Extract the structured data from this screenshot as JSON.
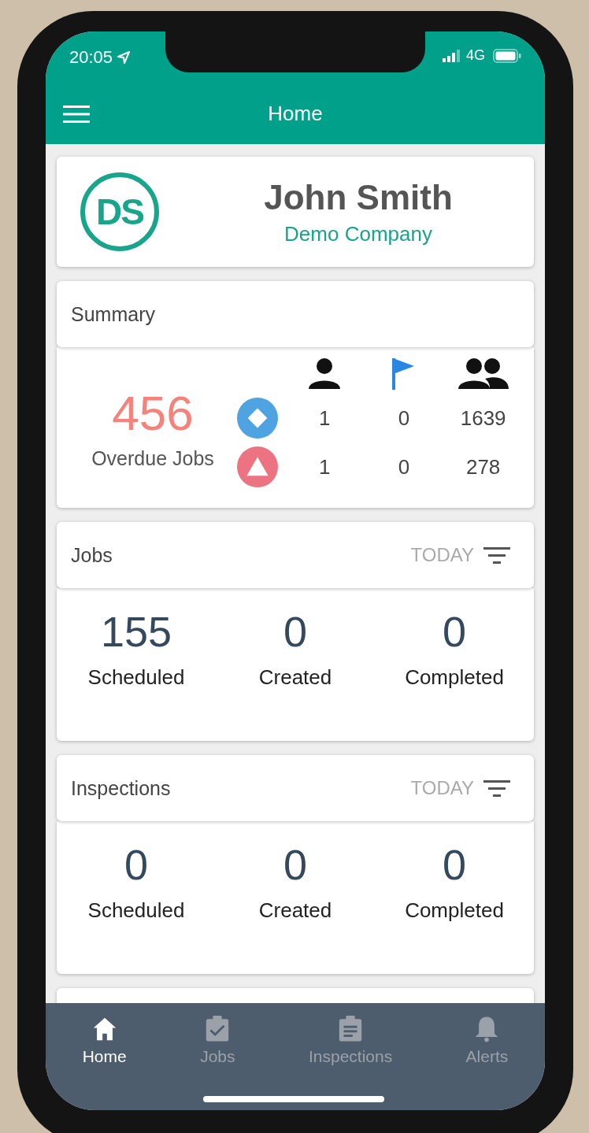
{
  "status_bar": {
    "time": "20:05",
    "network": "4G"
  },
  "app_bar": {
    "title": "Home"
  },
  "profile": {
    "initials": "DS",
    "name": "John Smith",
    "company": "Demo Company"
  },
  "summary": {
    "title": "Summary",
    "overdue_value": "456",
    "overdue_label": "Overdue Jobs",
    "rows": [
      {
        "kind": "diamond",
        "color": "#4fa3e0",
        "values": [
          "1",
          "0",
          "1639"
        ]
      },
      {
        "kind": "triangle",
        "color": "#ec7381",
        "values": [
          "1",
          "0",
          "278"
        ]
      }
    ]
  },
  "sections": [
    {
      "title": "Jobs",
      "filter": "TODAY",
      "stats": [
        {
          "value": "155",
          "label": "Scheduled"
        },
        {
          "value": "0",
          "label": "Created"
        },
        {
          "value": "0",
          "label": "Completed"
        }
      ]
    },
    {
      "title": "Inspections",
      "filter": "TODAY",
      "stats": [
        {
          "value": "0",
          "label": "Scheduled"
        },
        {
          "value": "0",
          "label": "Created"
        },
        {
          "value": "0",
          "label": "Completed"
        }
      ]
    }
  ],
  "nav": [
    {
      "kind": "home",
      "label": "Home",
      "selected": true
    },
    {
      "kind": "jobs",
      "label": "Jobs",
      "selected": false
    },
    {
      "kind": "inspections",
      "label": "Inspections",
      "selected": false
    },
    {
      "kind": "alerts",
      "label": "Alerts",
      "selected": false
    }
  ]
}
